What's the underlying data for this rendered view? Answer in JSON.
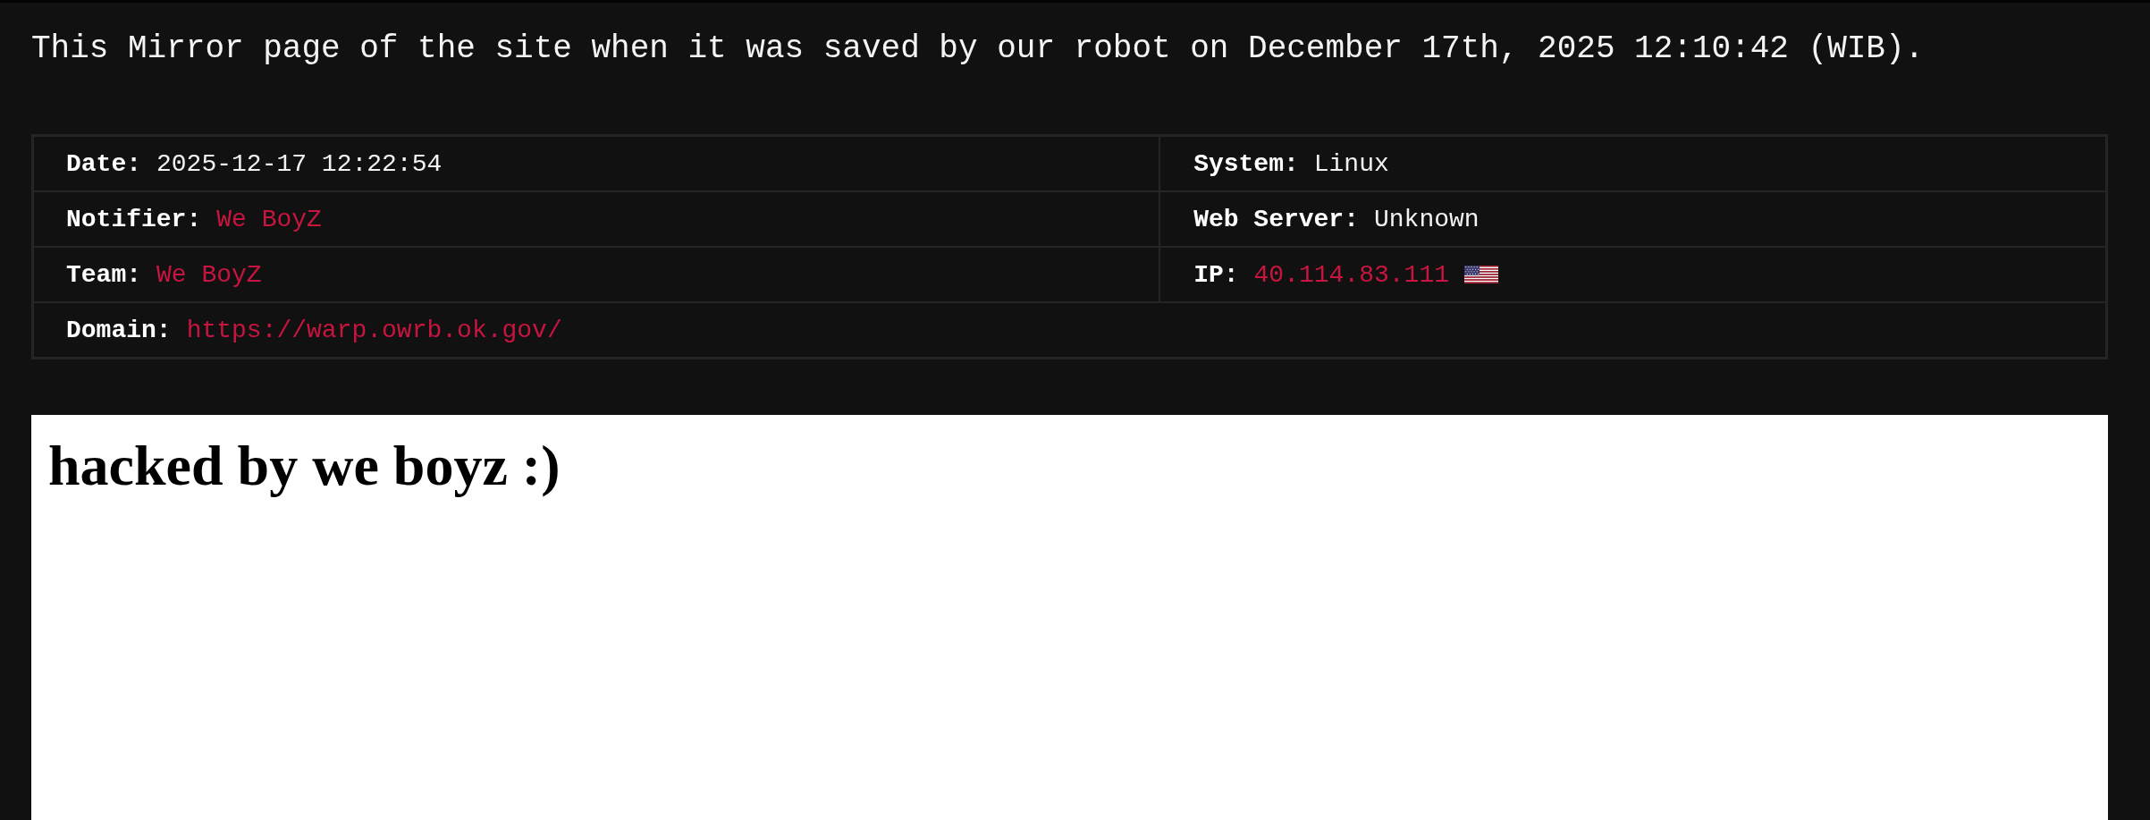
{
  "notice": {
    "text": "This Mirror page of the site when it was saved by our robot on December 17th, 2025 12:10:42 (WIB)."
  },
  "info_table": {
    "rows": [
      {
        "cells": [
          {
            "label": "Date:",
            "value": "2025-12-17 12:22:54",
            "kind": "text"
          },
          {
            "label": "System:",
            "value": "Linux",
            "kind": "text"
          }
        ]
      },
      {
        "cells": [
          {
            "label": "Notifier:",
            "value": "We BoyZ",
            "kind": "link"
          },
          {
            "label": "Web Server:",
            "value": "Unknown",
            "kind": "text"
          }
        ]
      },
      {
        "cells": [
          {
            "label": "Team:",
            "value": "We BoyZ",
            "kind": "link"
          },
          {
            "label": "IP:",
            "value": "40.114.83.111",
            "kind": "link",
            "flag": true
          }
        ]
      },
      {
        "cells": [
          {
            "label": "Domain:",
            "value": "https://warp.owrb.ok.gov/",
            "kind": "link"
          }
        ]
      }
    ]
  },
  "mirror": {
    "heading": "hacked by we boyz :)"
  }
}
